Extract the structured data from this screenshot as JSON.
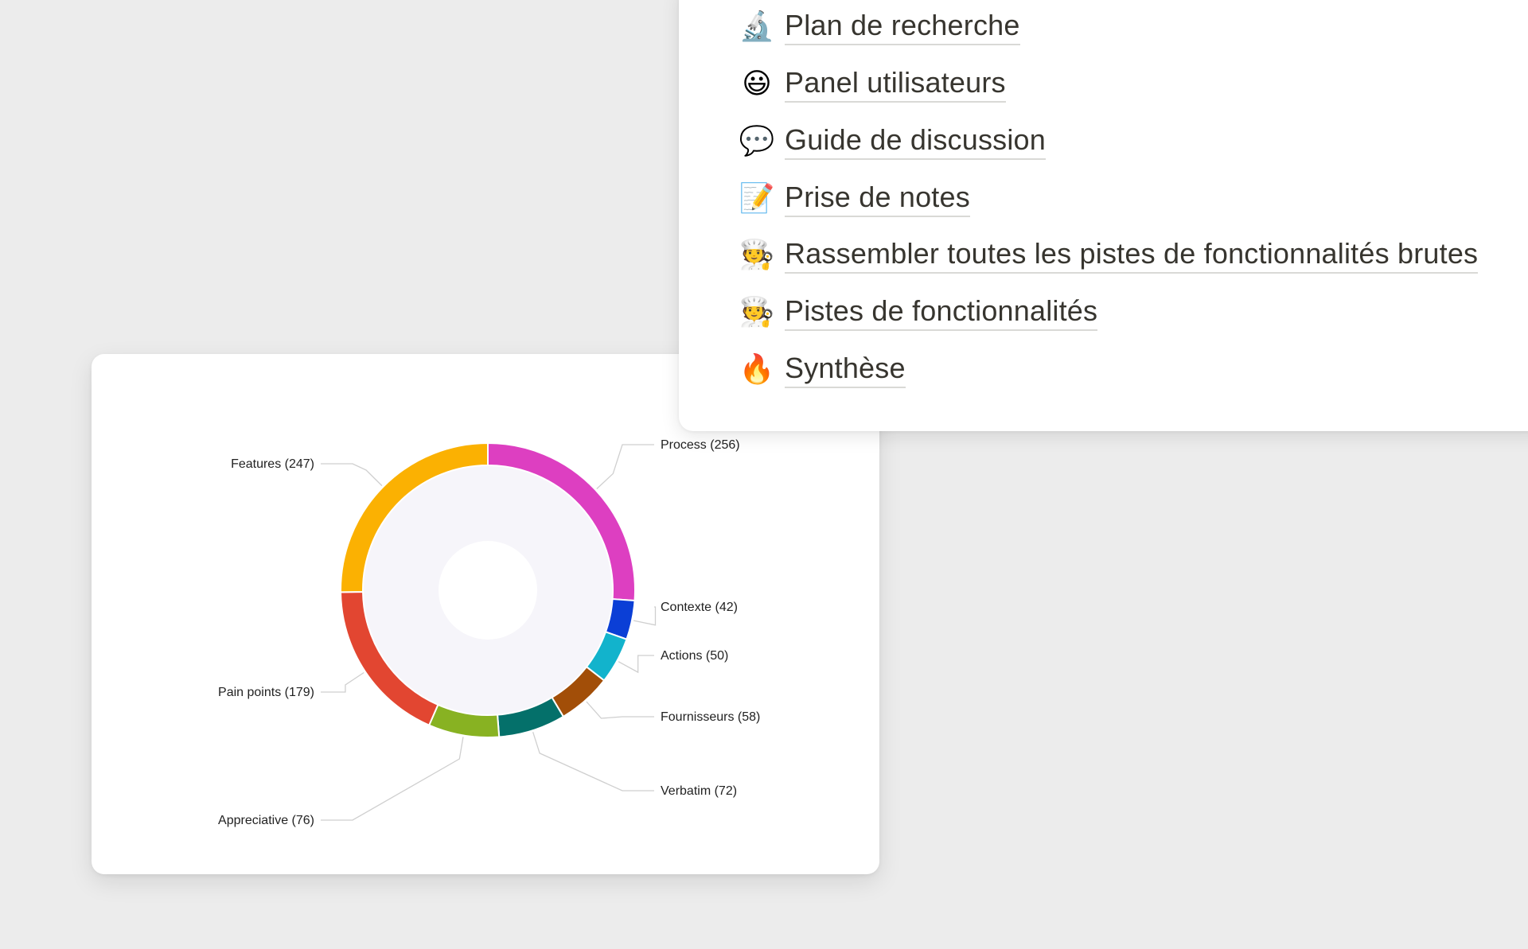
{
  "nav": {
    "items": [
      {
        "icon": "microscope-icon",
        "glyph": "🔬",
        "label": "Plan de recherche"
      },
      {
        "icon": "smiley-icon",
        "glyph": "😃",
        "label": "Panel utilisateurs"
      },
      {
        "icon": "speech-bubble-icon",
        "glyph": "💬",
        "label": "Guide de discussion"
      },
      {
        "icon": "memo-icon",
        "glyph": "📝",
        "label": "Prise de notes"
      },
      {
        "icon": "cook-icon",
        "glyph": "🧑‍🍳",
        "label": "Rassembler toutes les pistes de fonctionnalités brutes"
      },
      {
        "icon": "cook-icon",
        "glyph": "🧑‍🍳",
        "label": "Pistes de fonctionnalités"
      },
      {
        "icon": "fire-icon",
        "glyph": "🔥",
        "label": "Synthèse"
      }
    ]
  },
  "chart_data": {
    "type": "pie",
    "style": "donut",
    "title": "",
    "slices": [
      {
        "label": "Process (256)",
        "value": 256,
        "color": "#dd3fc1"
      },
      {
        "label": "Contexte (42)",
        "value": 42,
        "color": "#0b3fd6"
      },
      {
        "label": "Actions (50)",
        "value": 50,
        "color": "#12b3cc"
      },
      {
        "label": "Fournisseurs (58)",
        "value": 58,
        "color": "#a24e08"
      },
      {
        "label": "Verbatim (72)",
        "value": 72,
        "color": "#04706a"
      },
      {
        "label": "Appreciative (76)",
        "value": 76,
        "color": "#88b222"
      },
      {
        "label": "Pain points (179)",
        "value": 179,
        "color": "#e24631"
      },
      {
        "label": "Features (247)",
        "value": 247,
        "color": "#fbb102"
      }
    ],
    "inner_fill_color": "#f6f5fa",
    "legend": "none"
  }
}
